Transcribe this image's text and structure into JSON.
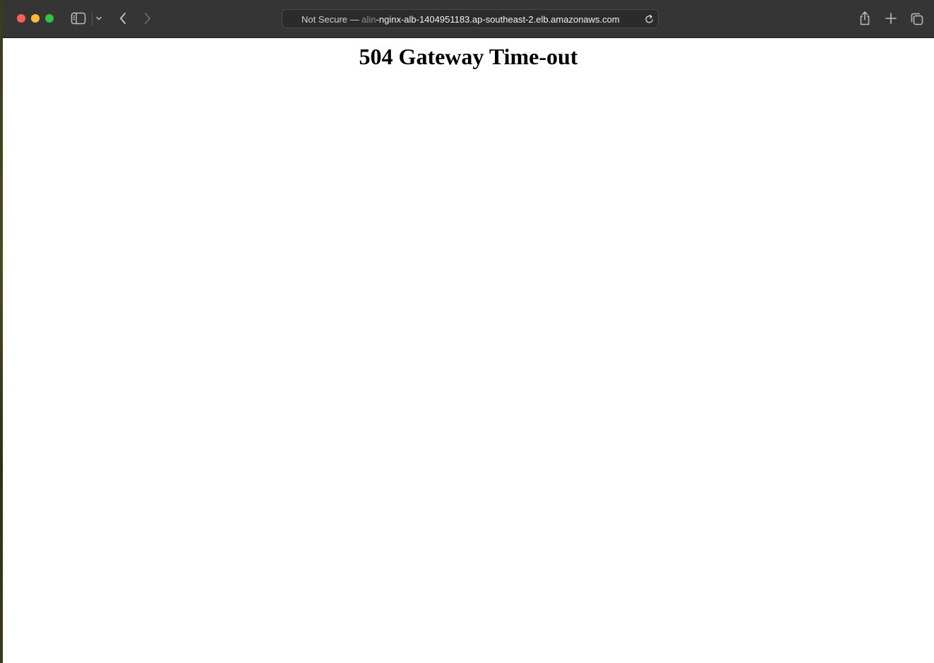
{
  "browser": {
    "address_bar": {
      "prefix": "Not Secure —",
      "faded": "alin",
      "host": "-nginx-alb-1404951183.ap-southeast-2.elb.amazonaws.com"
    },
    "icons": {
      "sidebar": "sidebar-icon",
      "chevron": "chevron-down-icon",
      "back": "chevron-left-icon",
      "forward": "chevron-right-icon",
      "reload": "reload-icon",
      "share": "share-icon",
      "new_tab": "plus-icon",
      "tab_overview": "tabs-icon"
    },
    "colors": {
      "toolbar": "#353535",
      "close": "#fe5f57",
      "minimize": "#febc2e",
      "maximize": "#28c840"
    }
  },
  "page": {
    "heading": "504 Gateway Time-out"
  }
}
